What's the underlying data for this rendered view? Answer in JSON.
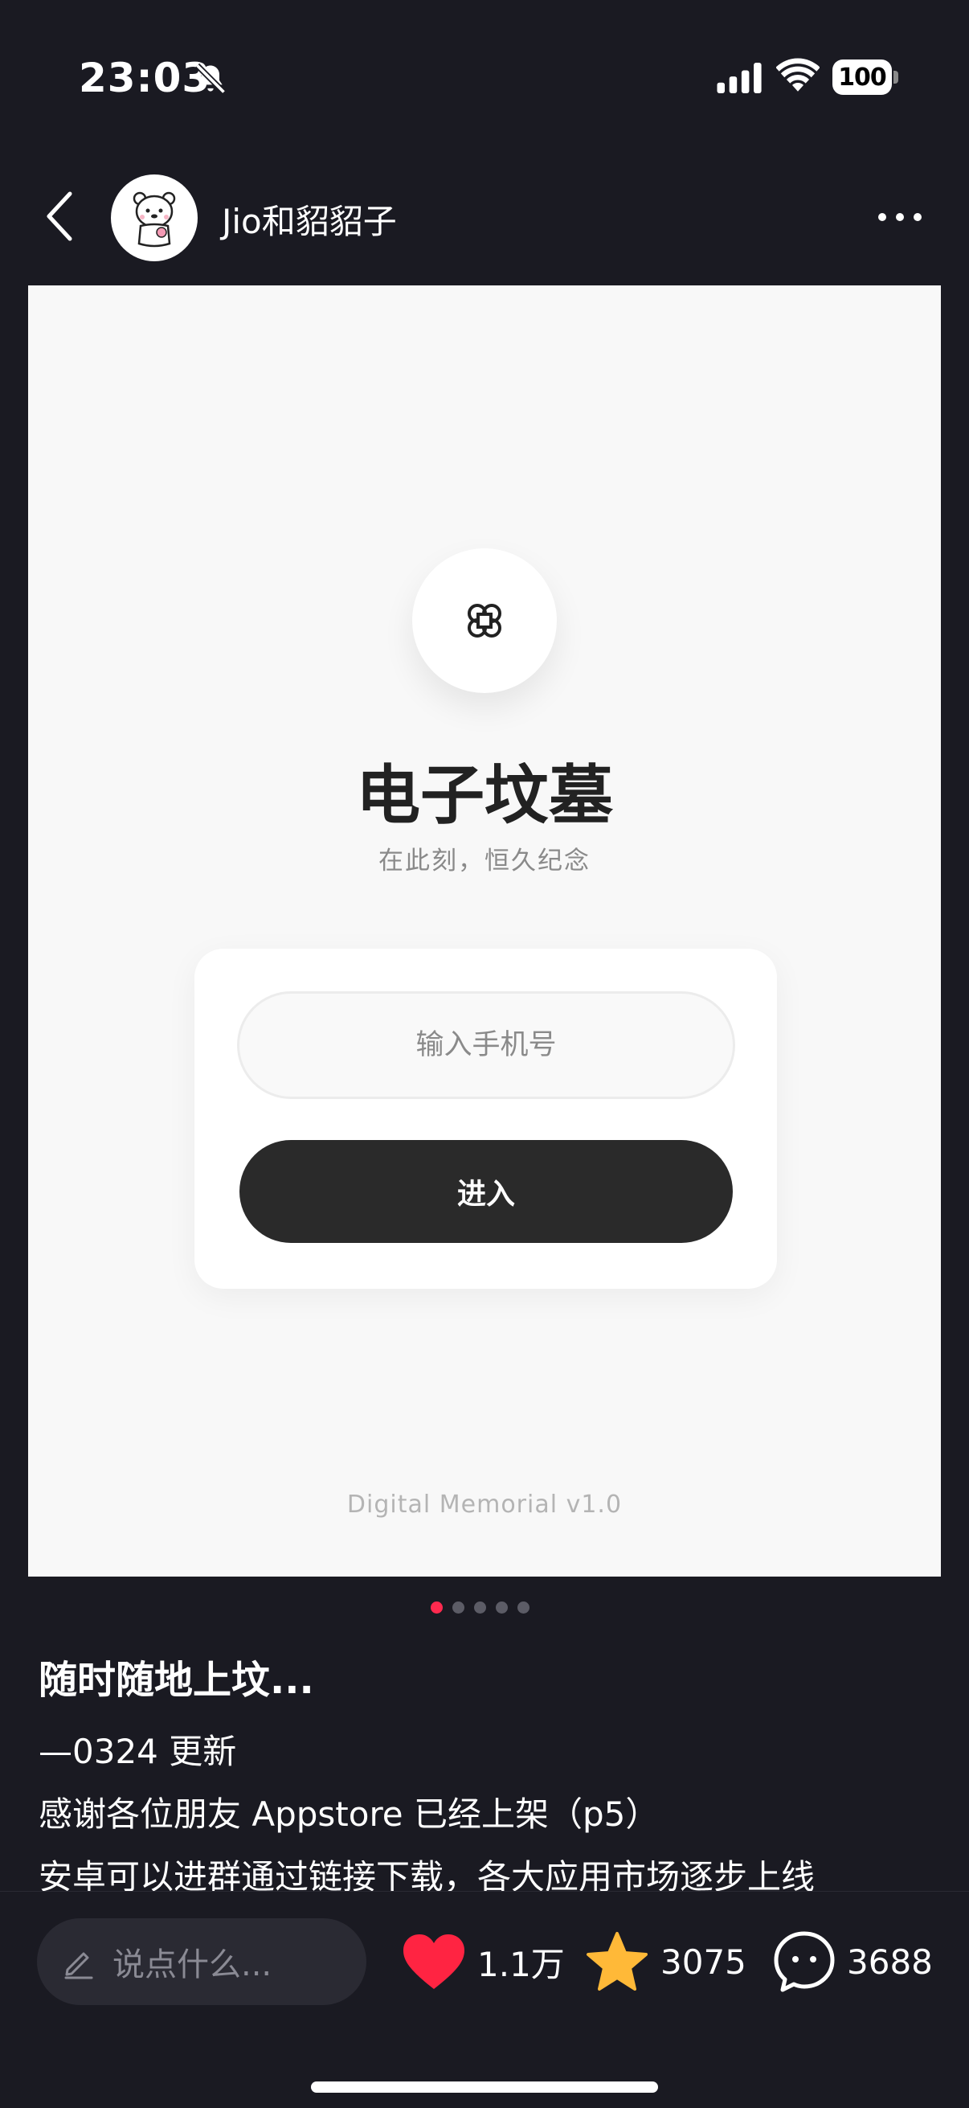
{
  "status_bar": {
    "time": "23:03",
    "battery": "100",
    "icons": [
      "bell-slash-icon",
      "signal-icon",
      "wifi-icon",
      "battery-icon"
    ]
  },
  "nav": {
    "author_name": "Jio和貂貂子",
    "icons": [
      "chevron-left-icon",
      "avatar",
      "more-icon"
    ]
  },
  "post_image": {
    "logo_icon": "clover-icon",
    "title": "电子坟墓",
    "subtitle": "在此刻，恒久纪念",
    "phone_placeholder": "输入手机号",
    "enter_label": "进入",
    "version": "Digital Memorial v1.0"
  },
  "pagination": {
    "total": 5,
    "current": 1
  },
  "post": {
    "title": "随时随地上坟...",
    "lines": [
      "—0324 更新",
      "感谢各位朋友 Appstore 已经上架（p5）",
      "安卓可以进群通过链接下载，各大应用市场逐步上线"
    ]
  },
  "bottom_bar": {
    "comment_placeholder": "说点什么...",
    "likes": "1.1万",
    "favorites": "3075",
    "comments": "3688",
    "colors": {
      "like": "#ff2442",
      "favorite": "#ffb938"
    }
  }
}
